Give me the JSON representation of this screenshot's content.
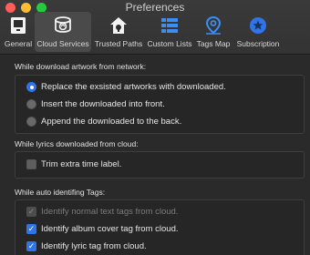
{
  "window": {
    "title": "Preferences",
    "traffic_lights": [
      "#ff5f57",
      "#febc2e",
      "#28c840"
    ]
  },
  "toolbar": {
    "tabs": [
      {
        "label": "General",
        "icon": "general-icon",
        "selected": false
      },
      {
        "label": "Cloud Services",
        "icon": "cloud-services-icon",
        "selected": true
      },
      {
        "label": "Trusted Paths",
        "icon": "trusted-paths-icon",
        "selected": false
      },
      {
        "label": "Custom Lists",
        "icon": "custom-lists-icon",
        "selected": false
      },
      {
        "label": "Tags Map",
        "icon": "tags-map-icon",
        "selected": false
      },
      {
        "label": "Subscription",
        "icon": "subscription-icon",
        "selected": false
      }
    ]
  },
  "artwork": {
    "title": "While download artwork from network:",
    "options": [
      {
        "label": "Replace the exsisted artworks with downloaded.",
        "selected": true
      },
      {
        "label": "Insert the downloaded into front.",
        "selected": false
      },
      {
        "label": "Append the downloaded to the back.",
        "selected": false
      }
    ]
  },
  "lyrics": {
    "title": "While lyrics downloaded from cloud:",
    "trim_label": "Trim extra time label.",
    "trim_checked": false
  },
  "tags": {
    "title": "While auto identifing Tags:",
    "items": [
      {
        "label": "Identify normal text tags from cloud.",
        "checked": true,
        "enabled": false
      },
      {
        "label": "Identify album cover tag from cloud.",
        "checked": true,
        "enabled": true
      },
      {
        "label": "Identify lyric tag from cloud.",
        "checked": true,
        "enabled": true
      }
    ]
  },
  "colors": {
    "accent": "#2f74e8",
    "background": "#2a2a2a"
  }
}
